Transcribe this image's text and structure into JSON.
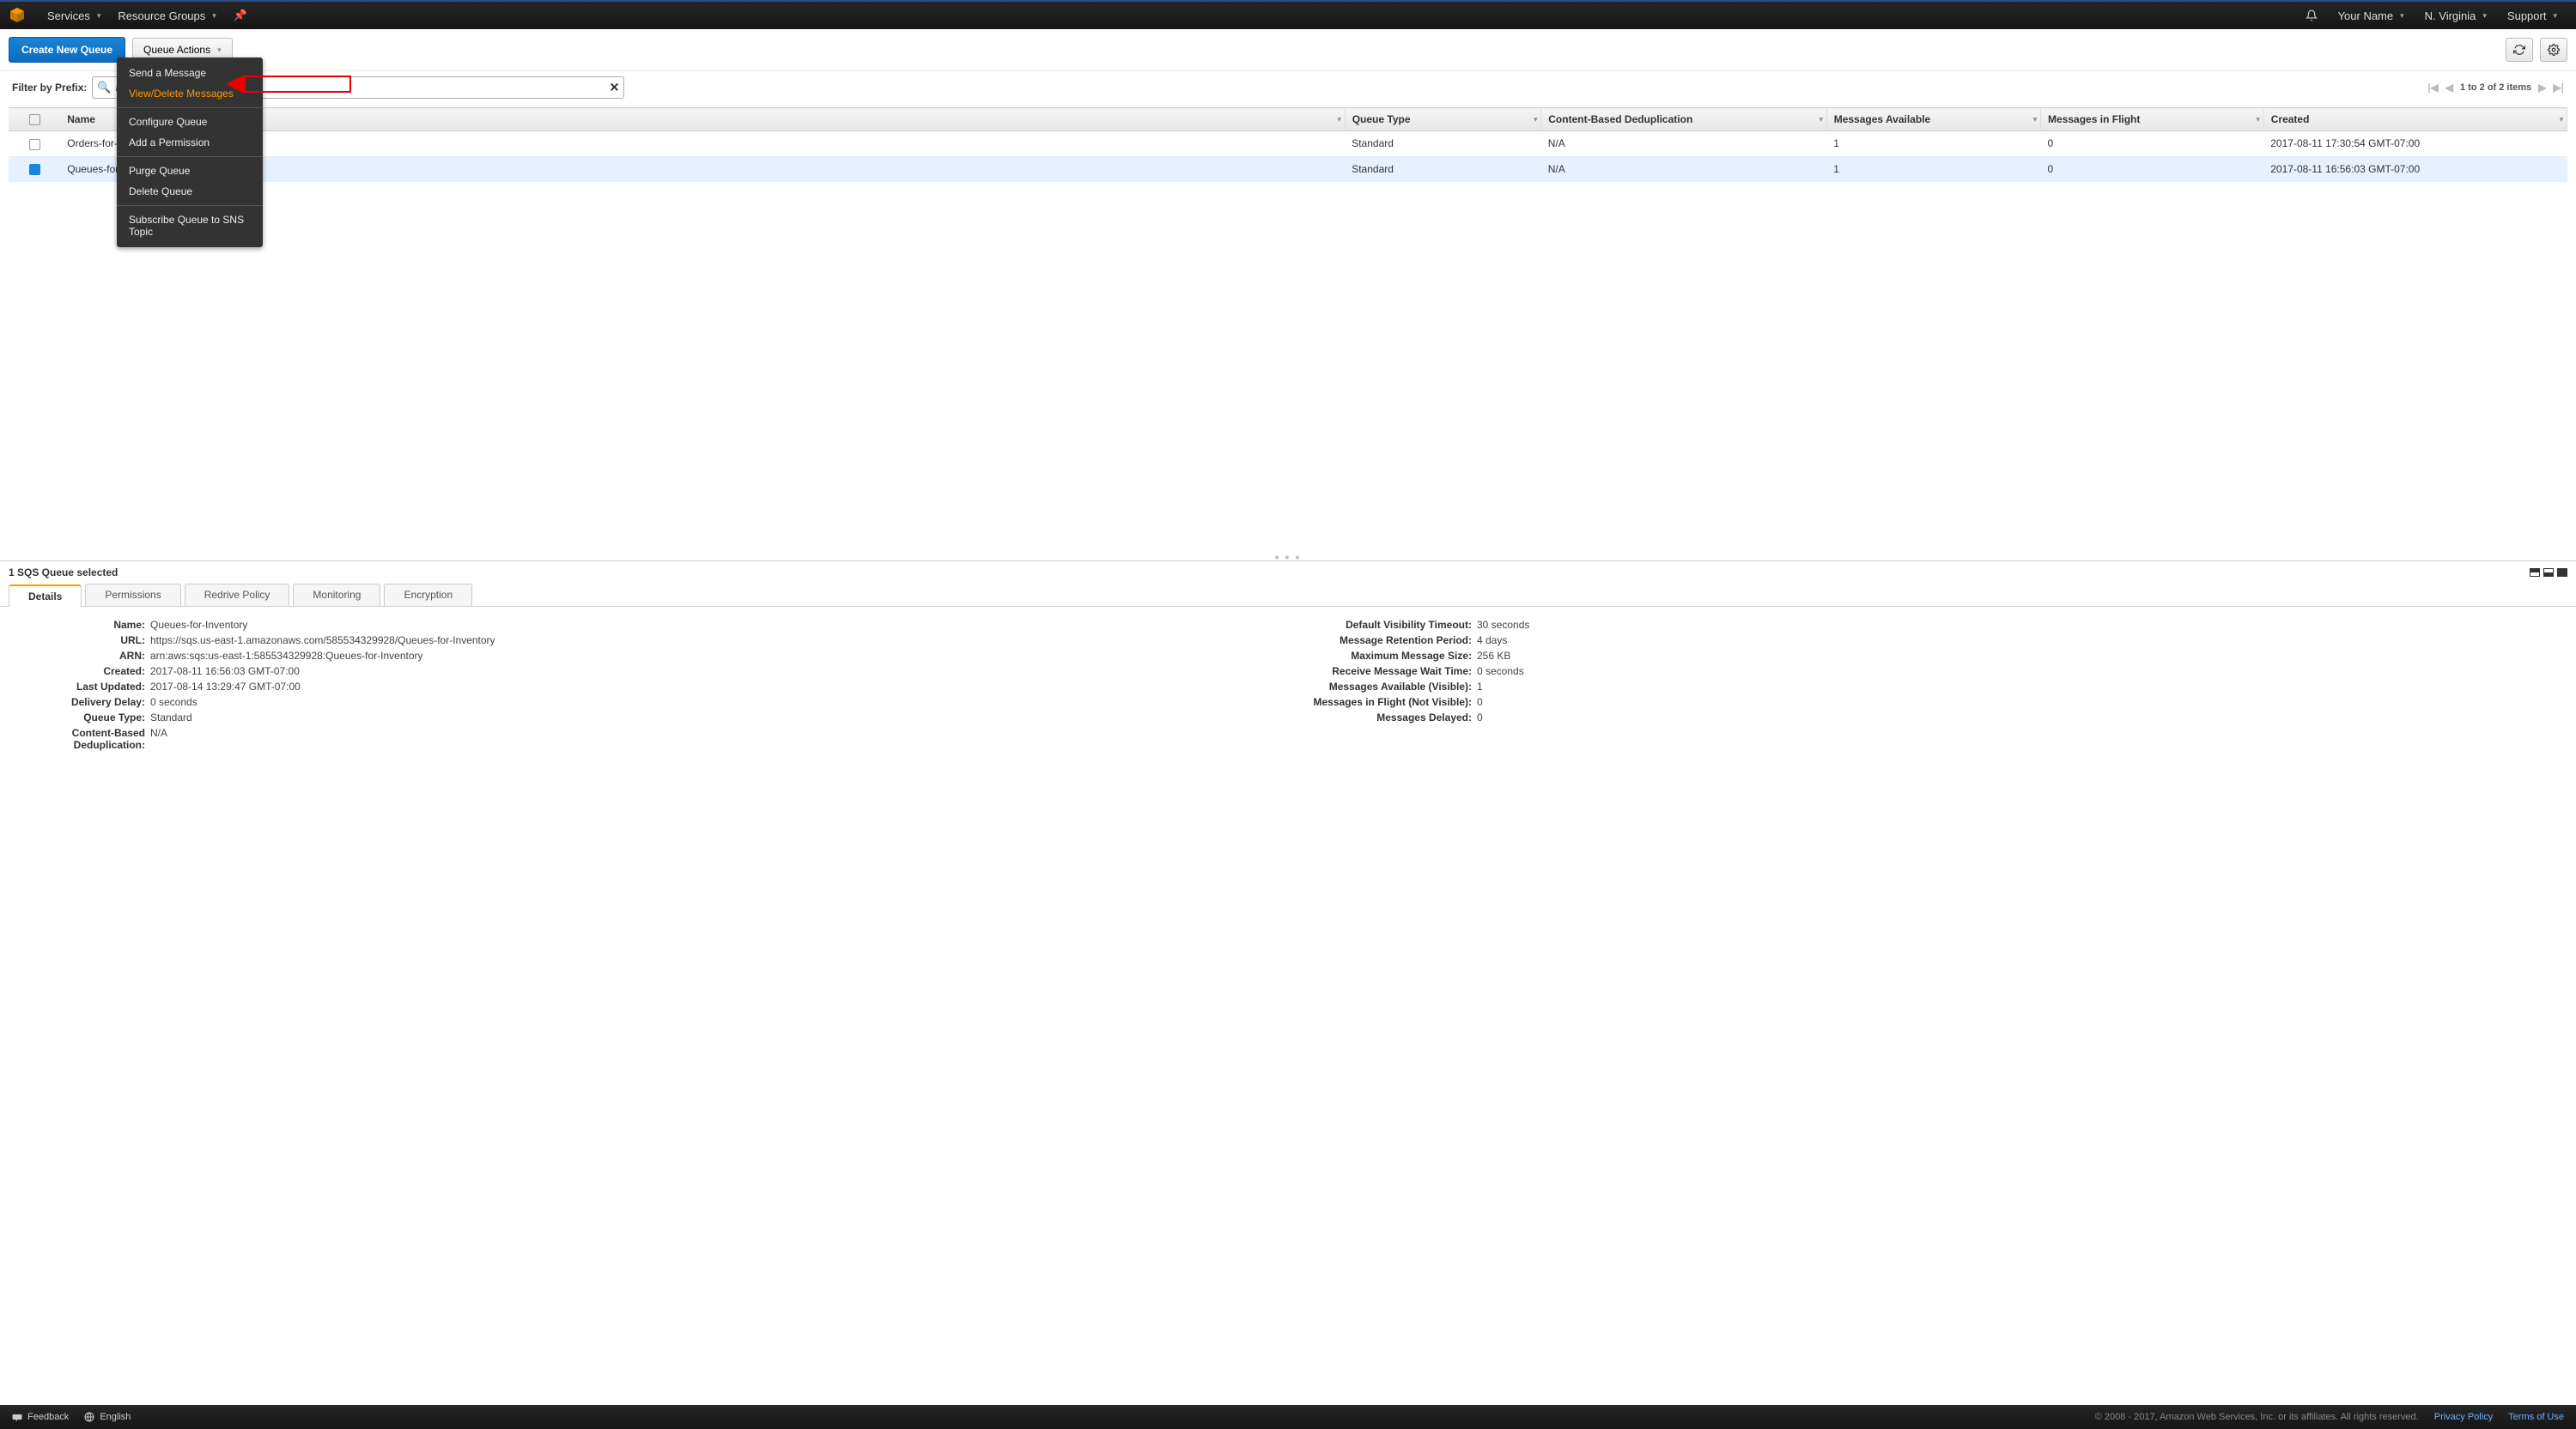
{
  "topbar": {
    "services": "Services",
    "resource_groups": "Resource Groups",
    "your_name": "Your Name",
    "region": "N. Virginia",
    "support": "Support"
  },
  "toolbar": {
    "create": "Create New Queue",
    "actions": "Queue Actions"
  },
  "filter": {
    "label": "Filter by Prefix:",
    "placeholder": "Enter Text",
    "clear": "✕"
  },
  "pager": {
    "text": "1 to 2 of 2 items"
  },
  "dropdown": {
    "items": [
      "Send a Message",
      "View/Delete Messages",
      "Configure Queue",
      "Add a Permission",
      "Purge Queue",
      "Delete Queue",
      "Subscribe Queue to SNS Topic"
    ]
  },
  "columns": {
    "name": "Name",
    "queue_type": "Queue Type",
    "cbd": "Content-Based Deduplication",
    "avail": "Messages Available",
    "inflight": "Messages in Flight",
    "created": "Created"
  },
  "rows": [
    {
      "selected": false,
      "name": "Orders-for-Analytics",
      "queue_type": "Standard",
      "cbd": "N/A",
      "avail": "1",
      "inflight": "0",
      "created": "2017-08-11 17:30:54 GMT-07:00"
    },
    {
      "selected": true,
      "name": "Queues-for-Inventory",
      "queue_type": "Standard",
      "cbd": "N/A",
      "avail": "1",
      "inflight": "0",
      "created": "2017-08-11 16:56:03 GMT-07:00"
    }
  ],
  "detail": {
    "status": "1 SQS Queue selected",
    "tabs": [
      "Details",
      "Permissions",
      "Redrive Policy",
      "Monitoring",
      "Encryption"
    ],
    "left": {
      "Name": "Queues-for-Inventory",
      "URL": "https://sqs.us-east-1.amazonaws.com/585534329928/Queues-for-Inventory",
      "ARN": "arn:aws:sqs:us-east-1:585534329928:Queues-for-Inventory",
      "Created": "2017-08-11 16:56:03 GMT-07:00",
      "LastUpdated": "2017-08-14 13:29:47 GMT-07:00",
      "DeliveryDelay": "0 seconds",
      "QueueType": "Standard",
      "CBD": "N/A"
    },
    "right": {
      "VisTimeout": "30 seconds",
      "Retention": "4 days",
      "MaxSize": "256 KB",
      "WaitTime": "0 seconds",
      "MsgAvail": "1",
      "MsgFlight": "0",
      "MsgDelayed": "0"
    },
    "labels_left": {
      "Name": "Name:",
      "URL": "URL:",
      "ARN": "ARN:",
      "Created": "Created:",
      "LastUpdated": "Last Updated:",
      "DeliveryDelay": "Delivery Delay:",
      "QueueType": "Queue Type:",
      "CBD": "Content-Based Deduplication:"
    },
    "labels_right": {
      "VisTimeout": "Default Visibility Timeout:",
      "Retention": "Message Retention Period:",
      "MaxSize": "Maximum Message Size:",
      "WaitTime": "Receive Message Wait Time:",
      "MsgAvail": "Messages Available (Visible):",
      "MsgFlight": "Messages in Flight (Not Visible):",
      "MsgDelayed": "Messages Delayed:"
    }
  },
  "footer": {
    "feedback": "Feedback",
    "language": "English",
    "copy": "© 2008 - 2017, Amazon Web Services, Inc. or its affiliates. All rights reserved.",
    "privacy": "Privacy Policy",
    "terms": "Terms of Use"
  }
}
